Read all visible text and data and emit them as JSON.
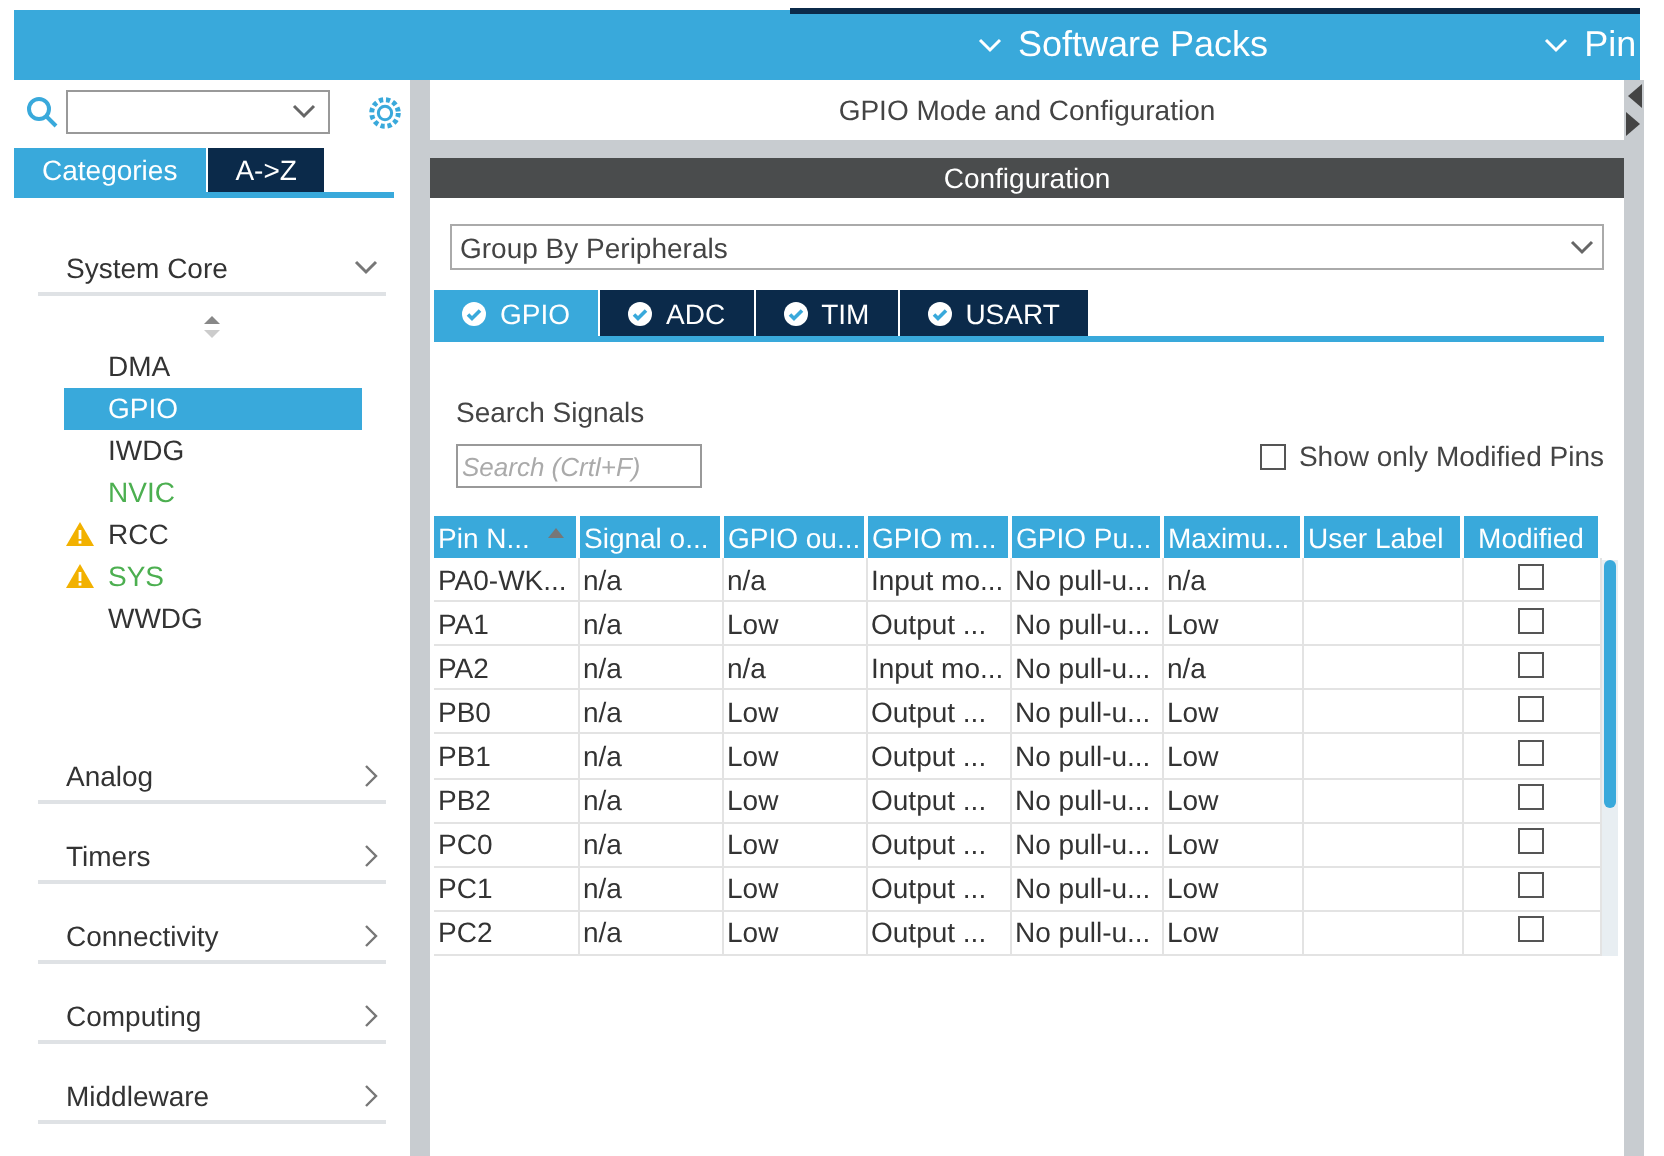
{
  "header": {
    "tabs": [
      {
        "label": "Software Packs"
      },
      {
        "label": "Pin"
      }
    ]
  },
  "sidebar": {
    "tabs": [
      {
        "label": "Categories",
        "selected": true
      },
      {
        "label": "A->Z",
        "selected": false
      }
    ],
    "categories": [
      {
        "name": "System Core",
        "expanded": true,
        "items": [
          {
            "label": "DMA",
            "selected": false,
            "warning": false
          },
          {
            "label": "GPIO",
            "selected": true,
            "warning": false
          },
          {
            "label": "IWDG",
            "selected": false,
            "warning": false
          },
          {
            "label": "NVIC",
            "selected": false,
            "warning": false,
            "color": "#4caf50"
          },
          {
            "label": "RCC",
            "selected": false,
            "warning": true
          },
          {
            "label": "SYS",
            "selected": false,
            "warning": true,
            "color": "#4caf50"
          },
          {
            "label": "WWDG",
            "selected": false,
            "warning": false
          }
        ]
      },
      {
        "name": "Analog",
        "expanded": false
      },
      {
        "name": "Timers",
        "expanded": false
      },
      {
        "name": "Connectivity",
        "expanded": false
      },
      {
        "name": "Computing",
        "expanded": false
      },
      {
        "name": "Middleware",
        "expanded": false
      }
    ]
  },
  "main": {
    "title": "GPIO Mode and Configuration",
    "section": "Configuration",
    "group_by": "Group By Peripherals",
    "tabs": [
      {
        "label": "GPIO",
        "selected": true
      },
      {
        "label": "ADC",
        "selected": false
      },
      {
        "label": "TIM",
        "selected": false
      },
      {
        "label": "USART",
        "selected": false
      }
    ],
    "search_label": "Search Signals",
    "search": {
      "placeholder": "Search (Crtl+F)"
    },
    "show_modified": {
      "label": "Show only Modified Pins",
      "checked": false
    },
    "table": {
      "columns": [
        {
          "label": "Pin N...",
          "sorted": true
        },
        {
          "label": "Signal o...",
          "sorted": false
        },
        {
          "label": "GPIO ou...",
          "sorted": false
        },
        {
          "label": "GPIO m...",
          "sorted": false
        },
        {
          "label": "GPIO Pu...",
          "sorted": false
        },
        {
          "label": "Maximu...",
          "sorted": false
        },
        {
          "label": "User Label",
          "sorted": false
        },
        {
          "label": "Modified",
          "sorted": false
        }
      ],
      "rows": [
        {
          "cells": [
            "PA0-WK...",
            "n/a",
            "n/a",
            "Input mo...",
            "No pull-u...",
            "n/a",
            ""
          ],
          "modified": false
        },
        {
          "cells": [
            "PA1",
            "n/a",
            "Low",
            "Output ...",
            "No pull-u...",
            "Low",
            ""
          ],
          "modified": false
        },
        {
          "cells": [
            "PA2",
            "n/a",
            "n/a",
            "Input mo...",
            "No pull-u...",
            "n/a",
            ""
          ],
          "modified": false
        },
        {
          "cells": [
            "PB0",
            "n/a",
            "Low",
            "Output ...",
            "No pull-u...",
            "Low",
            ""
          ],
          "modified": false
        },
        {
          "cells": [
            "PB1",
            "n/a",
            "Low",
            "Output ...",
            "No pull-u...",
            "Low",
            ""
          ],
          "modified": false
        },
        {
          "cells": [
            "PB2",
            "n/a",
            "Low",
            "Output ...",
            "No pull-u...",
            "Low",
            ""
          ],
          "modified": false
        },
        {
          "cells": [
            "PC0",
            "n/a",
            "Low",
            "Output ...",
            "No pull-u...",
            "Low",
            ""
          ],
          "modified": false
        },
        {
          "cells": [
            "PC1",
            "n/a",
            "Low",
            "Output ...",
            "No pull-u...",
            "Low",
            ""
          ],
          "modified": false
        },
        {
          "cells": [
            "PC2",
            "n/a",
            "Low",
            "Output ...",
            "No pull-u...",
            "Low",
            ""
          ],
          "modified": false
        }
      ]
    }
  }
}
